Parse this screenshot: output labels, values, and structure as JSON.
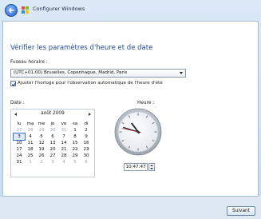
{
  "window": {
    "title": "Configurer Windows"
  },
  "page": {
    "heading": "Vérifier les paramètres d'heure et de date"
  },
  "timezone": {
    "label": "Fuseau horaire :",
    "selected": "(UTC+01:00) Bruxelles, Copenhague, Madrid, Paris"
  },
  "dst": {
    "label": "Ajuster l'horloge pour l'observation automatique de l'heure d'été",
    "checked": true
  },
  "date": {
    "label": "Date :",
    "month": "août 2009",
    "weekdays": [
      "lu",
      "ma",
      "me",
      "je",
      "ve",
      "sa",
      "di"
    ],
    "weeks": [
      [
        "27",
        "28",
        "29",
        "30",
        "31",
        "1",
        "2"
      ],
      [
        "3",
        "4",
        "5",
        "6",
        "7",
        "8",
        "9"
      ],
      [
        "10",
        "11",
        "12",
        "13",
        "14",
        "15",
        "16"
      ],
      [
        "17",
        "18",
        "19",
        "20",
        "21",
        "22",
        "23"
      ],
      [
        "24",
        "25",
        "26",
        "27",
        "28",
        "29",
        "30"
      ],
      [
        "31",
        "1",
        "2",
        "3",
        "4",
        "5",
        "6"
      ]
    ],
    "selected_day": "3"
  },
  "time": {
    "label": "Heure :",
    "value": "10:47:47",
    "hour": 10,
    "minute": 47,
    "second": 47
  },
  "footer": {
    "next_label": "Suivant"
  },
  "colors": {
    "heading": "#1f4e98",
    "selection": "#3b73c4"
  }
}
